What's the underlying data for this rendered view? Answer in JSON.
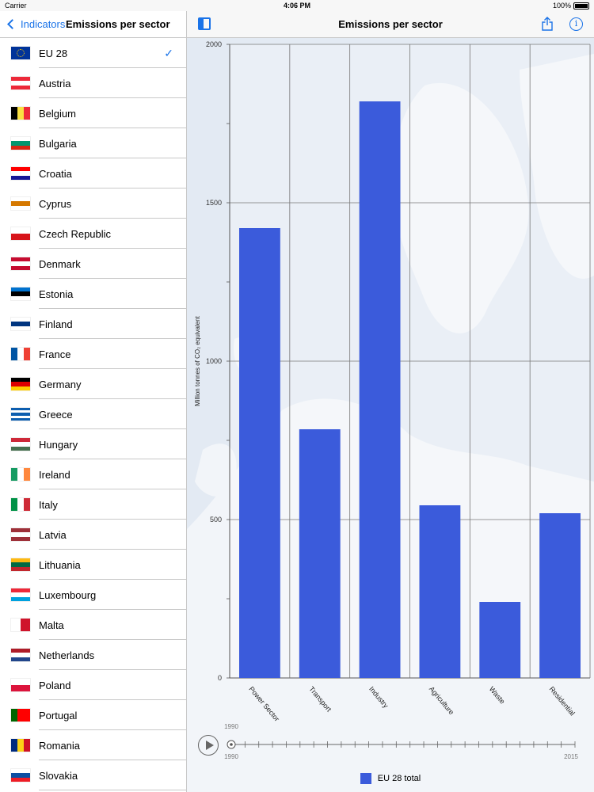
{
  "status": {
    "carrier": "Carrier",
    "time": "4:06 PM",
    "battery": "100%"
  },
  "sidebar": {
    "back_label": "Indicators",
    "title": "Emissions per sector",
    "countries": [
      {
        "name": "EU 28",
        "selected": true,
        "flag": "eu"
      },
      {
        "name": "Austria",
        "flag": [
          "#ed2939",
          "#ffffff",
          "#ed2939"
        ]
      },
      {
        "name": "Belgium",
        "flag_v": [
          "#000000",
          "#fae042",
          "#ed2939"
        ]
      },
      {
        "name": "Bulgaria",
        "flag": [
          "#ffffff",
          "#00966e",
          "#d62612"
        ]
      },
      {
        "name": "Croatia",
        "flag": [
          "#ff0000",
          "#ffffff",
          "#171796"
        ]
      },
      {
        "name": "Cyprus",
        "flag": [
          "#ffffff",
          "#d57800",
          "#ffffff"
        ]
      },
      {
        "name": "Czech Republic",
        "flag": [
          "#ffffff",
          "#d7141a"
        ]
      },
      {
        "name": "Denmark",
        "flag": [
          "#c60c30",
          "#ffffff",
          "#c60c30"
        ]
      },
      {
        "name": "Estonia",
        "flag": [
          "#0072ce",
          "#000000",
          "#ffffff"
        ]
      },
      {
        "name": "Finland",
        "flag": [
          "#ffffff",
          "#003580",
          "#ffffff"
        ]
      },
      {
        "name": "France",
        "flag_v": [
          "#0055a4",
          "#ffffff",
          "#ef4135"
        ]
      },
      {
        "name": "Germany",
        "flag": [
          "#000000",
          "#dd0000",
          "#ffce00"
        ]
      },
      {
        "name": "Greece",
        "flag": [
          "#0d5eaf",
          "#ffffff",
          "#0d5eaf",
          "#ffffff",
          "#0d5eaf"
        ]
      },
      {
        "name": "Hungary",
        "flag": [
          "#ce2939",
          "#ffffff",
          "#477050"
        ]
      },
      {
        "name": "Ireland",
        "flag_v": [
          "#169b62",
          "#ffffff",
          "#ff883e"
        ]
      },
      {
        "name": "Italy",
        "flag_v": [
          "#009246",
          "#ffffff",
          "#ce2b37"
        ]
      },
      {
        "name": "Latvia",
        "flag": [
          "#9e3039",
          "#ffffff",
          "#9e3039"
        ]
      },
      {
        "name": "Lithuania",
        "flag": [
          "#fdb913",
          "#006a44",
          "#c1272d"
        ]
      },
      {
        "name": "Luxembourg",
        "flag": [
          "#ed2939",
          "#ffffff",
          "#00a1de"
        ]
      },
      {
        "name": "Malta",
        "flag_v": [
          "#ffffff",
          "#cf142b"
        ]
      },
      {
        "name": "Netherlands",
        "flag": [
          "#ae1c28",
          "#ffffff",
          "#21468b"
        ]
      },
      {
        "name": "Poland",
        "flag": [
          "#ffffff",
          "#dc143c"
        ]
      },
      {
        "name": "Portugal",
        "flag_v": [
          "#006600",
          "#ff0000",
          "#ff0000"
        ]
      },
      {
        "name": "Romania",
        "flag_v": [
          "#002b7f",
          "#fcd116",
          "#ce1126"
        ]
      },
      {
        "name": "Slovakia",
        "flag": [
          "#ffffff",
          "#0b4ea2",
          "#ee1c25"
        ]
      }
    ]
  },
  "main": {
    "title": "Emissions per sector"
  },
  "timeline": {
    "start": "1990",
    "end": "2015",
    "current": "1990"
  },
  "legend": {
    "label": "EU 28 total",
    "color": "#3b5bdb"
  },
  "chart_data": {
    "type": "bar",
    "categories": [
      "Power Sector",
      "Transport",
      "Industry",
      "Agriculture",
      "Waste",
      "Residential"
    ],
    "series": [
      {
        "name": "EU 28 total",
        "values": [
          1420,
          785,
          1820,
          545,
          240,
          520
        ]
      }
    ],
    "ylabel": "Million tonnes of CO₂ equivalent",
    "ylim": [
      0,
      2000
    ],
    "yticks": [
      0,
      500,
      1000,
      1500,
      2000
    ],
    "grid": true,
    "color": "#3b5bdb"
  }
}
